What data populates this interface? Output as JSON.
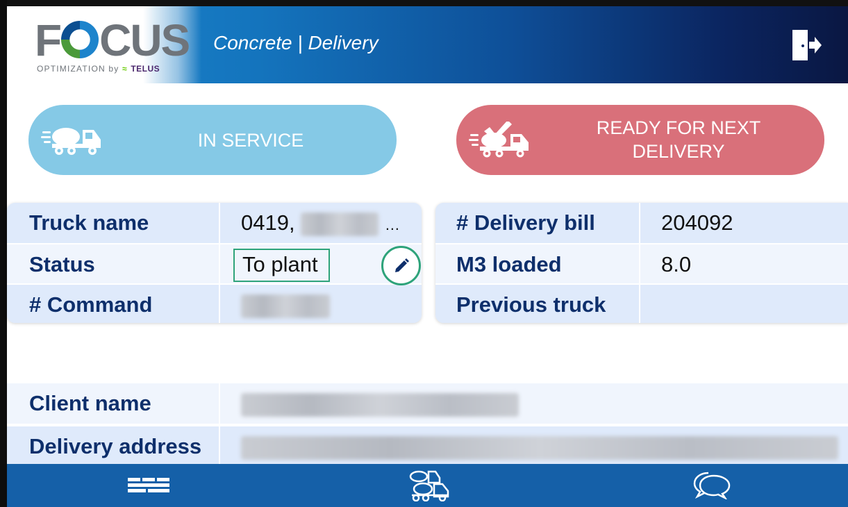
{
  "header": {
    "logo_main_pre": "F",
    "logo_main_post": "CUS",
    "logo_sub": "OPTIMIZATION by",
    "logo_telus": "TELUS",
    "app_title": "Concrete | Delivery",
    "exit_icon": "exit-door-icon"
  },
  "actions": {
    "in_service_label": "IN SERVICE",
    "ready_label": "READY FOR NEXT DELIVERY",
    "in_service_color": "#85c9e6",
    "ready_color": "#d9707a"
  },
  "truck_info": {
    "truck_name_label": "Truck name",
    "truck_name_value": "0419,",
    "truck_name_ellipsis": "…",
    "status_label": "Status",
    "status_value": "To plant",
    "command_label": "# Command"
  },
  "delivery_info": {
    "delivery_bill_label": "# Delivery bill",
    "delivery_bill_value": "204092",
    "m3_label": "M3 loaded",
    "m3_value": "8.0",
    "previous_truck_label": "Previous truck",
    "previous_truck_value": ""
  },
  "client": {
    "client_name_label": "Client name",
    "delivery_address_label": "Delivery address"
  },
  "nav": {
    "items": [
      "list-icon",
      "trucks-icon",
      "chat-icon"
    ],
    "accent": "#1560a8"
  },
  "colors": {
    "label_text": "#0e2f6b",
    "edit_accent": "#2ea37a"
  }
}
